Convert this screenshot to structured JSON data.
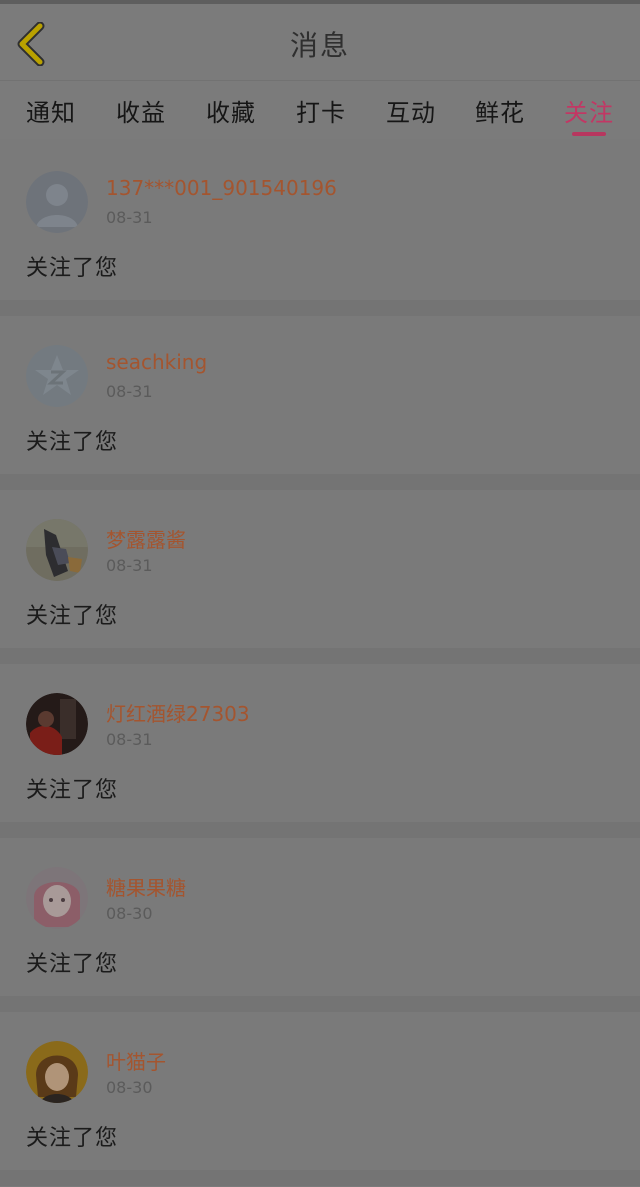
{
  "header": {
    "title": "消息"
  },
  "tabs": [
    {
      "label": "通知"
    },
    {
      "label": "收益"
    },
    {
      "label": "收藏"
    },
    {
      "label": "打卡"
    },
    {
      "label": "互动"
    },
    {
      "label": "鲜花"
    },
    {
      "label": "关注",
      "active": true
    }
  ],
  "messages": [
    {
      "name": "137***001_901540196",
      "date": "08-31",
      "text": "关注了您",
      "avatar": "default-person-avatar"
    },
    {
      "name": "seachking",
      "date": "08-31",
      "text": "关注了您",
      "avatar": "qq-zone-star-avatar"
    },
    {
      "name": "梦露露酱",
      "date": "08-31",
      "text": "关注了您",
      "avatar": "photo-avatar"
    },
    {
      "name": "灯红酒绿27303",
      "date": "08-31",
      "text": "关注了您",
      "avatar": "photo-avatar"
    },
    {
      "name": "糖果果糖",
      "date": "08-30",
      "text": "关注了您",
      "avatar": "anime-avatar"
    },
    {
      "name": "叶猫子",
      "date": "08-30",
      "text": "关注了您",
      "avatar": "anime-avatar"
    }
  ],
  "colors": {
    "accent": "#c23764",
    "name": "#a4552f",
    "back_icon": "#d7c20a"
  }
}
